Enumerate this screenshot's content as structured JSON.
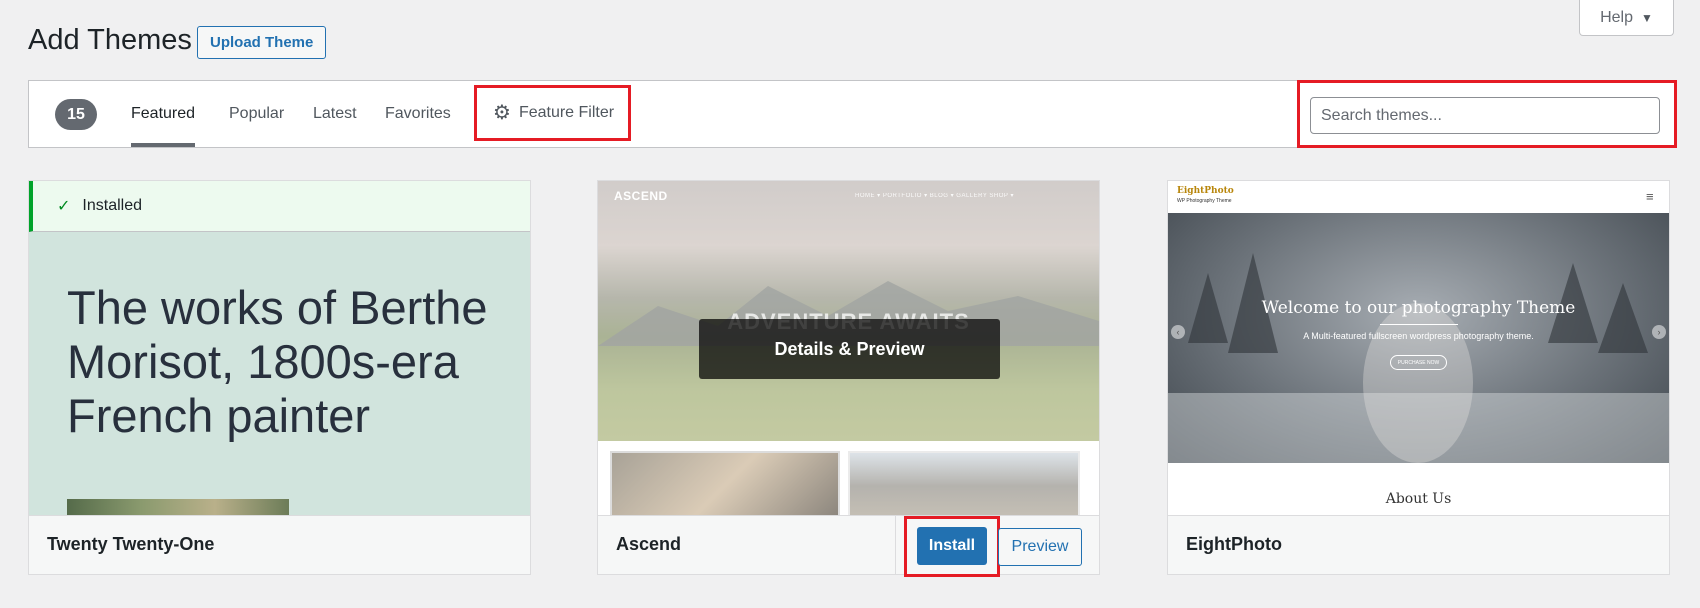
{
  "help": {
    "label": "Help"
  },
  "header": {
    "title": "Add Themes",
    "upload_label": "Upload Theme"
  },
  "filter_bar": {
    "count": "15",
    "tabs": [
      {
        "label": "Featured",
        "active": true
      },
      {
        "label": "Popular"
      },
      {
        "label": "Latest"
      },
      {
        "label": "Favorites"
      }
    ],
    "feature_filter_label": "Feature Filter",
    "search_placeholder": "Search themes..."
  },
  "themes": [
    {
      "name": "Twenty Twenty-One",
      "installed_label": "Installed",
      "screenshot": {
        "headline": "The works of Berthe Morisot, 1800s-era French painter"
      }
    },
    {
      "name": "Ascend",
      "details_label": "Details & Preview",
      "install_label": "Install",
      "preview_label": "Preview",
      "screenshot": {
        "logo": "ASCEND",
        "nav": "HOME ▾  PORTFOLIO ▾  BLOG ▾  GALLERY  SHOP ▾",
        "hero_title": "ADVENTURE AWAITS"
      }
    },
    {
      "name": "EightPhoto",
      "screenshot": {
        "logo": "EightPhoto",
        "tagline": "WP Photography Theme",
        "hero_title": "Welcome to our photography Theme",
        "hero_sub": "A Multi-featured fullscreen wordpress photography theme.",
        "hero_button": "PURCHASE NOW",
        "section_title": "About Us"
      }
    }
  ],
  "colors": {
    "accent": "#2271b1",
    "highlight": "#e51b24",
    "installed": "#00a32a"
  }
}
